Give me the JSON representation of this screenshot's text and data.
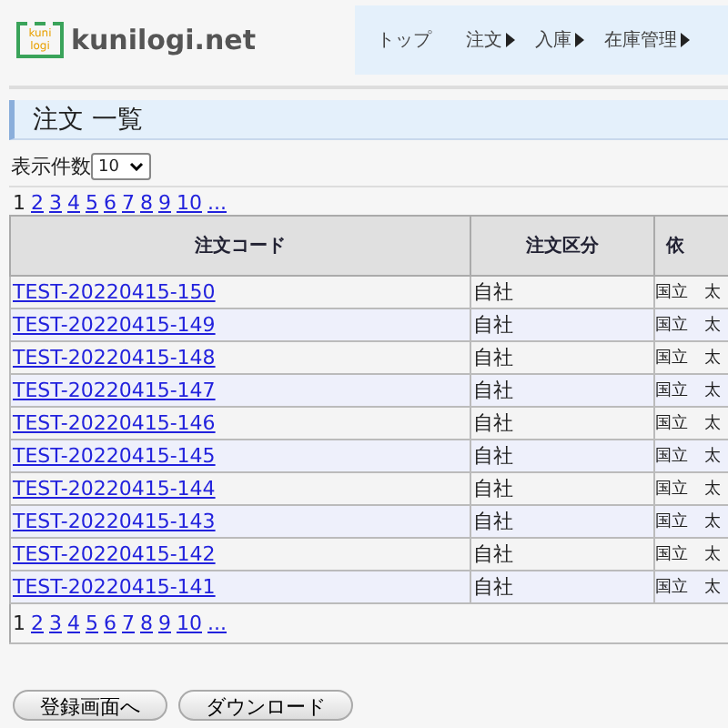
{
  "header": {
    "logo_badge": "kuni logi",
    "site_name": "kunilogi.net",
    "nav": [
      {
        "label": "トップ",
        "has_submenu": false
      },
      {
        "label": "注文",
        "has_submenu": true
      },
      {
        "label": "入庫",
        "has_submenu": true
      },
      {
        "label": "在庫管理",
        "has_submenu": true
      }
    ]
  },
  "page_title": "注文 一覧",
  "page_size": {
    "label": "表示件数",
    "value": "10"
  },
  "pagination_top": [
    {
      "label": "1",
      "selected": true
    },
    {
      "label": "2",
      "selected": false
    },
    {
      "label": "3",
      "selected": false
    },
    {
      "label": "4",
      "selected": false
    },
    {
      "label": "5",
      "selected": false
    },
    {
      "label": "6",
      "selected": false
    },
    {
      "label": "7",
      "selected": false
    },
    {
      "label": "8",
      "selected": false
    },
    {
      "label": "9",
      "selected": false
    },
    {
      "label": "10",
      "selected": false
    },
    {
      "label": "...",
      "selected": false
    }
  ],
  "table": {
    "columns": [
      "注文コード",
      "注文区分",
      "依"
    ],
    "rows": [
      [
        "TEST-20220415-150",
        "自社",
        "国立　太"
      ],
      [
        "TEST-20220415-149",
        "自社",
        "国立　太"
      ],
      [
        "TEST-20220415-148",
        "自社",
        "国立　太"
      ],
      [
        "TEST-20220415-147",
        "自社",
        "国立　太"
      ],
      [
        "TEST-20220415-146",
        "自社",
        "国立　太"
      ],
      [
        "TEST-20220415-145",
        "自社",
        "国立　太"
      ],
      [
        "TEST-20220415-144",
        "自社",
        "国立　太"
      ],
      [
        "TEST-20220415-143",
        "自社",
        "国立　太"
      ],
      [
        "TEST-20220415-142",
        "自社",
        "国立　太"
      ],
      [
        "TEST-20220415-141",
        "自社",
        "国立　太"
      ]
    ]
  },
  "pagination_bottom": [
    {
      "label": "1",
      "selected": true
    },
    {
      "label": "2",
      "selected": false
    },
    {
      "label": "3",
      "selected": false
    },
    {
      "label": "4",
      "selected": false
    },
    {
      "label": "5",
      "selected": false
    },
    {
      "label": "6",
      "selected": false
    },
    {
      "label": "7",
      "selected": false
    },
    {
      "label": "8",
      "selected": false
    },
    {
      "label": "9",
      "selected": false
    },
    {
      "label": "10",
      "selected": false
    },
    {
      "label": "...",
      "selected": false
    }
  ],
  "buttons": [
    "登録画面へ",
    "ダウンロード"
  ]
}
